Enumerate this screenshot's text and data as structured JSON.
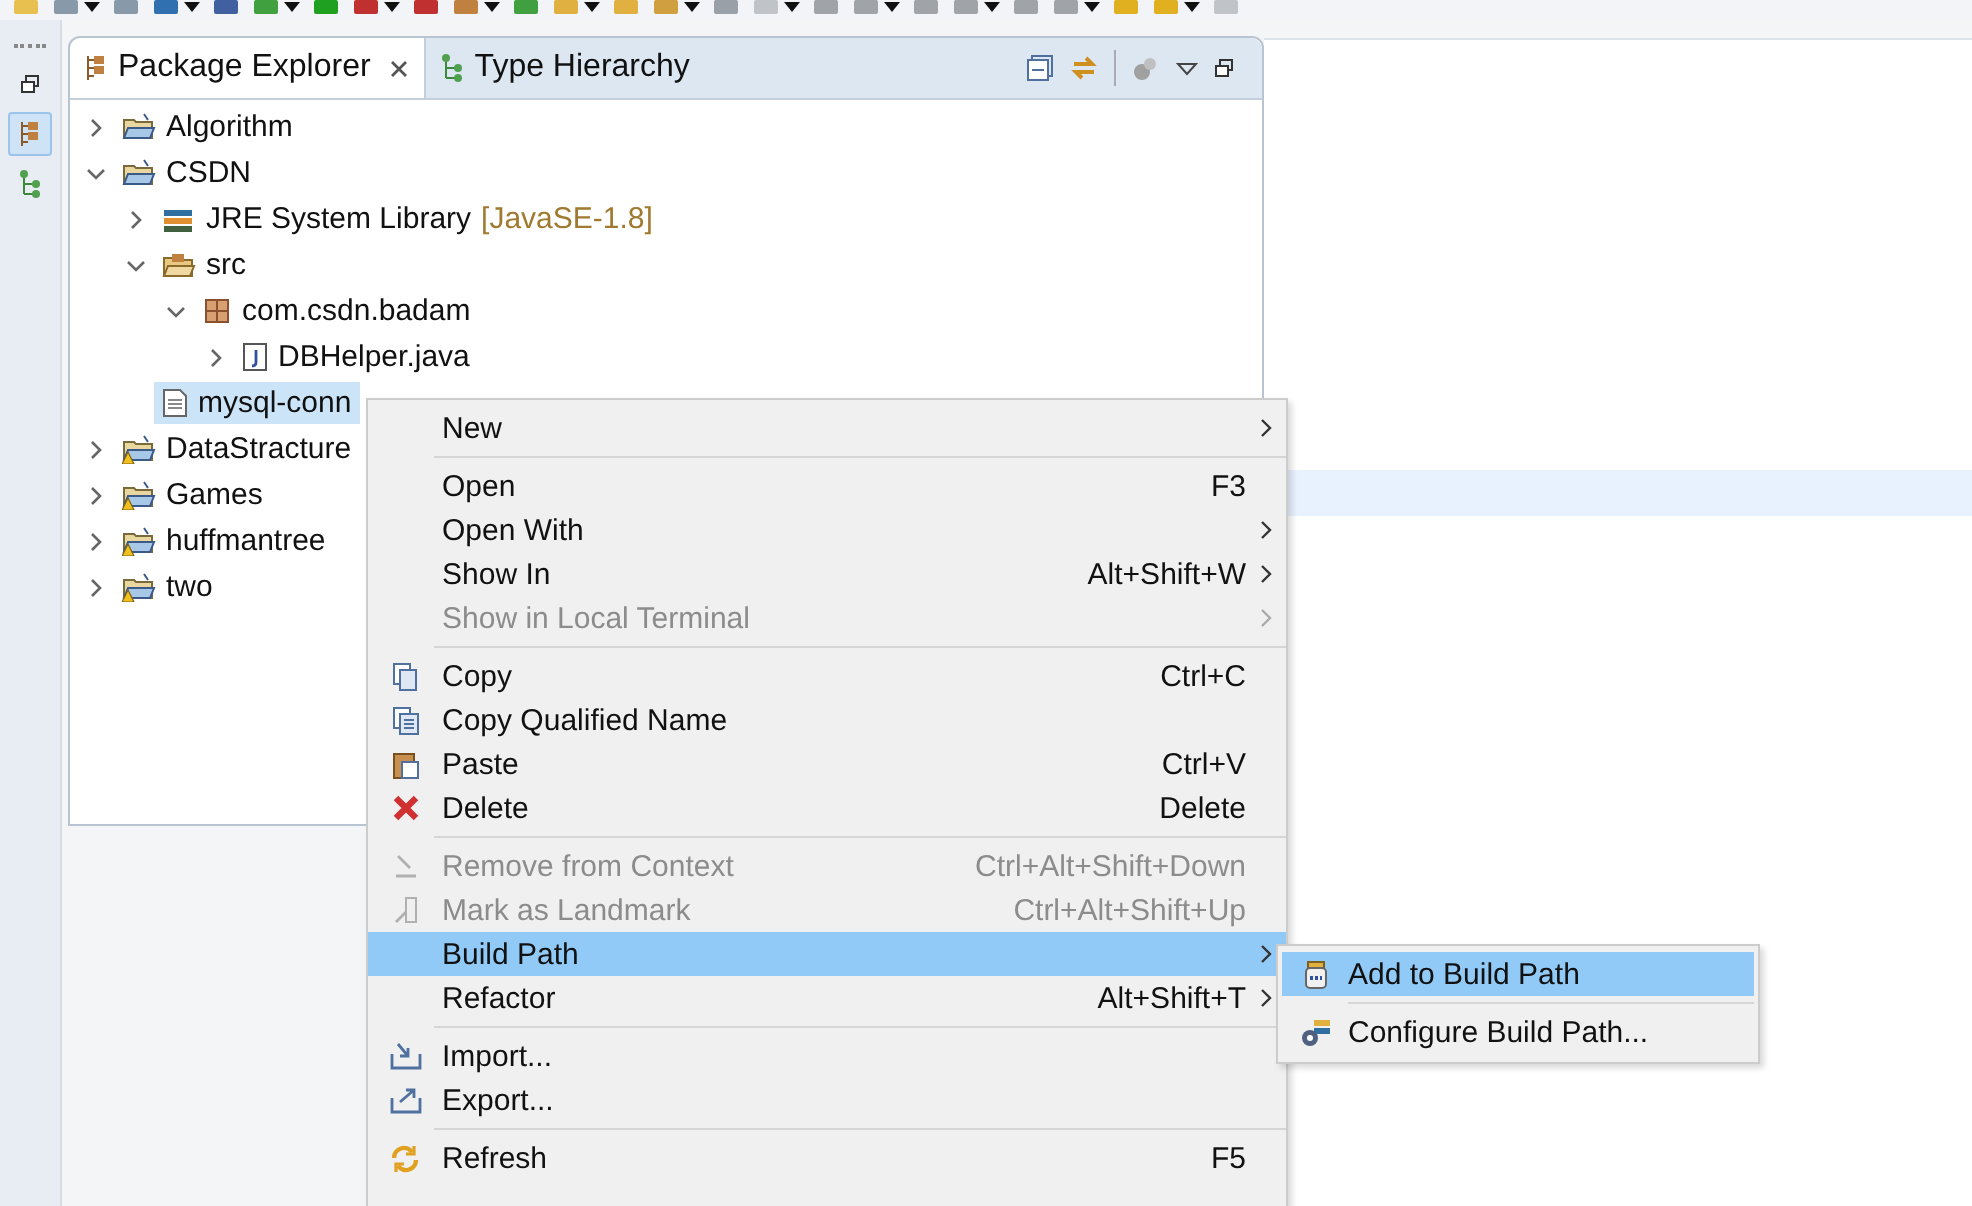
{
  "side_strip": {
    "buttons": [
      {
        "selected": false
      },
      {
        "selected": true
      },
      {
        "selected": false
      }
    ]
  },
  "tabs": [
    {
      "label": "Package Explorer",
      "selected": true,
      "closable": true
    },
    {
      "label": "Type Hierarchy",
      "selected": false,
      "closable": false
    }
  ],
  "tree": [
    {
      "label": "Algorithm",
      "kind": "project",
      "expanded": false,
      "selected": false,
      "has_arrow": true
    },
    {
      "label": "CSDN",
      "kind": "project",
      "expanded": true,
      "selected": false,
      "has_arrow": true,
      "children": [
        {
          "label": "JRE System Library",
          "decoration": "[JavaSE-1.8]",
          "kind": "library",
          "expanded": false,
          "selected": false,
          "has_arrow": true
        },
        {
          "label": "src",
          "kind": "source",
          "expanded": true,
          "selected": false,
          "has_arrow": true,
          "children": [
            {
              "label": "com.csdn.badam",
              "kind": "package",
              "expanded": true,
              "selected": false,
              "has_arrow": true,
              "children": [
                {
                  "label": "DBHelper.java",
                  "kind": "java",
                  "expanded": false,
                  "selected": false,
                  "has_arrow": true
                }
              ]
            }
          ]
        },
        {
          "label": "mysql-conn",
          "kind": "file",
          "selected": true,
          "has_arrow": false
        }
      ]
    },
    {
      "label": "DataStracture",
      "kind": "project_warning",
      "expanded": false,
      "selected": false,
      "has_arrow": true
    },
    {
      "label": "Games",
      "kind": "project_warning",
      "expanded": false,
      "selected": false,
      "has_arrow": true
    },
    {
      "label": "huffmantree",
      "kind": "project_warning",
      "expanded": false,
      "selected": false,
      "has_arrow": true
    },
    {
      "label": "two",
      "kind": "project_warning",
      "expanded": false,
      "selected": false,
      "has_arrow": true
    }
  ],
  "context_menu": [
    {
      "kind": "item",
      "label": "New",
      "submenu": true,
      "disabled": false,
      "selected": false
    },
    {
      "kind": "separator"
    },
    {
      "kind": "item",
      "label": "Open",
      "shortcut": "F3",
      "submenu": false,
      "disabled": false,
      "selected": false
    },
    {
      "kind": "item",
      "label": "Open With",
      "submenu": true,
      "disabled": false,
      "selected": false
    },
    {
      "kind": "item",
      "label": "Show In",
      "shortcut": "Alt+Shift+W",
      "submenu": true,
      "disabled": false,
      "selected": false
    },
    {
      "kind": "item",
      "label": "Show in Local Terminal",
      "submenu": true,
      "disabled": true,
      "selected": false
    },
    {
      "kind": "separator"
    },
    {
      "kind": "item",
      "label": "Copy",
      "shortcut": "Ctrl+C",
      "submenu": false,
      "disabled": false,
      "selected": false
    },
    {
      "kind": "item",
      "label": "Copy Qualified Name",
      "submenu": false,
      "disabled": false,
      "selected": false
    },
    {
      "kind": "item",
      "label": "Paste",
      "shortcut": "Ctrl+V",
      "submenu": false,
      "disabled": false,
      "selected": false
    },
    {
      "kind": "item",
      "label": "Delete",
      "shortcut": "Delete",
      "submenu": false,
      "disabled": false,
      "selected": false
    },
    {
      "kind": "separator"
    },
    {
      "kind": "item",
      "label": "Remove from Context",
      "shortcut": "Ctrl+Alt+Shift+Down",
      "submenu": false,
      "disabled": true,
      "selected": false
    },
    {
      "kind": "item",
      "label": "Mark as Landmark",
      "shortcut": "Ctrl+Alt+Shift+Up",
      "submenu": false,
      "disabled": true,
      "selected": false
    },
    {
      "kind": "item",
      "label": "Build Path",
      "submenu": true,
      "disabled": false,
      "selected": true
    },
    {
      "kind": "item",
      "label": "Refactor",
      "shortcut": "Alt+Shift+T",
      "submenu": true,
      "disabled": false,
      "selected": false
    },
    {
      "kind": "separator"
    },
    {
      "kind": "item",
      "label": "Import...",
      "submenu": false,
      "disabled": false,
      "selected": false
    },
    {
      "kind": "item",
      "label": "Export...",
      "submenu": false,
      "disabled": false,
      "selected": false
    },
    {
      "kind": "separator"
    },
    {
      "kind": "item",
      "label": "Refresh",
      "shortcut": "F5",
      "submenu": false,
      "disabled": false,
      "selected": false
    }
  ],
  "submenu": [
    {
      "kind": "item",
      "label": "Add to Build Path",
      "selected": true
    },
    {
      "kind": "separator"
    },
    {
      "kind": "item",
      "label": "Configure Build Path...",
      "selected": false
    }
  ]
}
